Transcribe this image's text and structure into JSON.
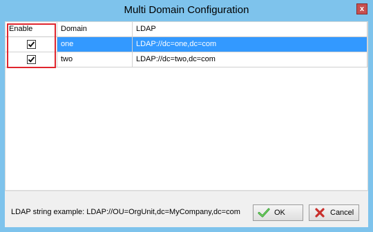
{
  "window": {
    "title": "Multi Domain Configuration",
    "close_glyph": "x"
  },
  "grid": {
    "columns": [
      "Enable",
      "Domain",
      "LDAP"
    ],
    "rows": [
      {
        "enabled": true,
        "domain": "one",
        "ldap": "LDAP://dc=one,dc=com",
        "selected": true
      },
      {
        "enabled": true,
        "domain": "two",
        "ldap": "LDAP://dc=two,dc=com",
        "selected": false
      }
    ]
  },
  "footer": {
    "hint": "LDAP string example: LDAP://OU=OrgUnit,dc=MyCompany,dc=com",
    "ok_label": "OK",
    "cancel_label": "Cancel"
  },
  "icons": {
    "ok": "green-check-icon",
    "cancel": "red-x-icon",
    "checkbox": "checkmark-icon"
  },
  "colors": {
    "titlebar": "#7ec3ec",
    "selection": "#3399ff",
    "highlight": "#e0252d",
    "close": "#c75050"
  }
}
